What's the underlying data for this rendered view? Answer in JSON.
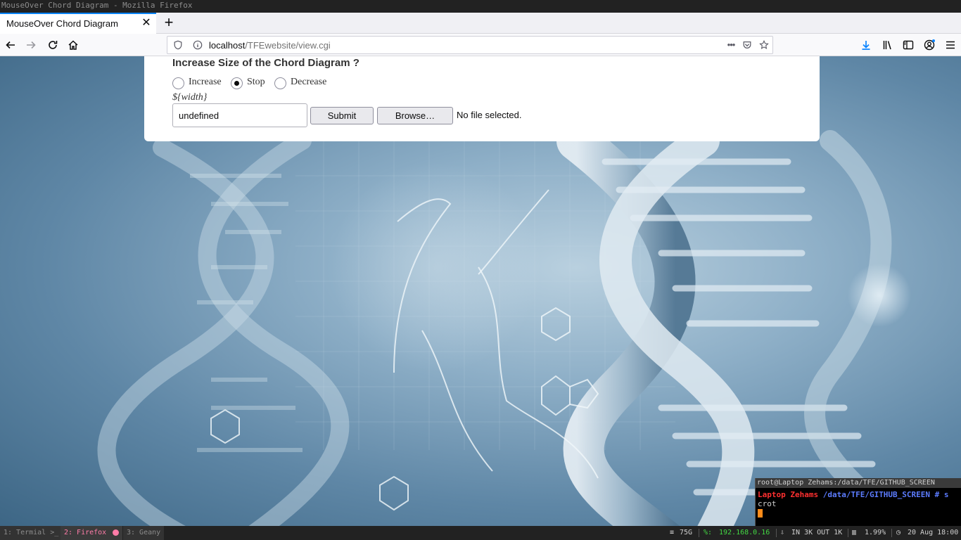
{
  "window": {
    "title": "MouseOver Chord Diagram - Mozilla Firefox"
  },
  "browser": {
    "tab": {
      "title": "MouseOver Chord Diagram",
      "close_glyph": "✕"
    },
    "newtab_glyph": "+",
    "url": {
      "host": "localhost",
      "path": "/TFEwebsite/view.cgi"
    },
    "page_actions_glyph": "•••",
    "icons": [
      "back-icon",
      "forward-icon",
      "reload-icon",
      "home-icon",
      "shield-icon",
      "info-icon",
      "pocket-icon",
      "bookmark-star-icon",
      "downloads-icon",
      "library-icon",
      "sidebar-icon",
      "account-icon",
      "menu-icon"
    ],
    "accent_color": "#0a84ff"
  },
  "form": {
    "title": "Increase Size of the Chord Diagram ?",
    "radios": [
      {
        "label": "Increase",
        "checked": false
      },
      {
        "label": "Stop",
        "checked": true
      },
      {
        "label": "Decrease",
        "checked": false
      }
    ],
    "width_label": "${width}",
    "width_value": "undefined",
    "submit_label": "Submit",
    "browse_label": "Browse…",
    "file_status": "No file selected."
  },
  "terminal": {
    "title": "root@Laptop Zehams:/data/TFE/GITHUB_SCREEN",
    "host": "Laptop Zehams",
    "path": "/data/TFE/GITHUB_SCREEN",
    "prompt_symbol": "# s",
    "command_rest": "crot"
  },
  "statusbar": {
    "workspaces": [
      {
        "label": "1: Termial >_"
      },
      {
        "label": "2: Firefox"
      },
      {
        "label": "3: Geany"
      }
    ],
    "disk": "75G",
    "ip": "192.168.0.16",
    "net": "IN 3K OUT 1K",
    "cpu": "1.99%",
    "clock": "20 Aug 18:00"
  }
}
